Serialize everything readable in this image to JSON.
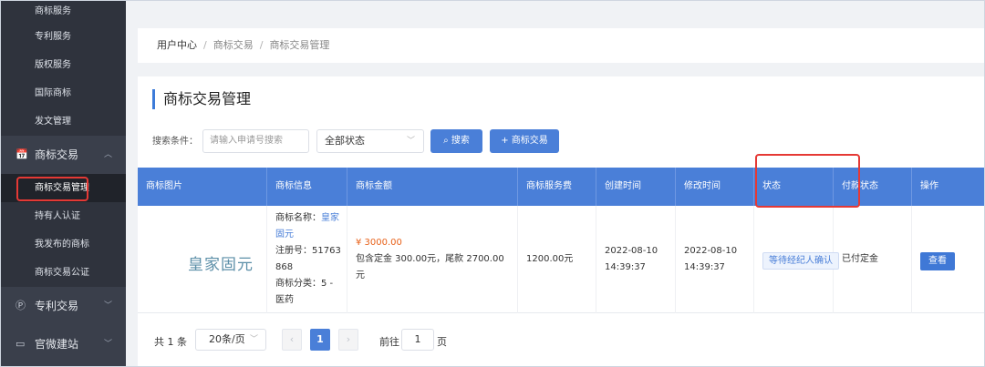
{
  "sidebar": {
    "top_items": [
      {
        "label": "商标服务"
      },
      {
        "label": "专利服务"
      },
      {
        "label": "版权服务"
      },
      {
        "label": "国际商标"
      },
      {
        "label": "发文管理"
      }
    ],
    "group_trademark": {
      "label": "商标交易",
      "icon": "shop-icon"
    },
    "sub_items": [
      {
        "label": "商标交易管理",
        "active": true
      },
      {
        "label": "持有人认证"
      },
      {
        "label": "我发布的商标"
      },
      {
        "label": "商标交易公证"
      }
    ],
    "group_patent": {
      "label": "专利交易",
      "icon": "patent-icon"
    },
    "group_site": {
      "label": "官微建站",
      "icon": "monitor-icon"
    }
  },
  "breadcrumb": {
    "home": "用户中心",
    "level1": "商标交易",
    "level2": "商标交易管理"
  },
  "page_title": "商标交易管理",
  "search": {
    "label": "搜索条件：",
    "placeholder": "请输入申请号搜索",
    "status_select": "全部状态",
    "search_button": "搜索",
    "add_button": "商标交易"
  },
  "table": {
    "headers": [
      "商标图片",
      "商标信息",
      "商标金额",
      "商标服务费",
      "创建时间",
      "修改时间",
      "状态",
      "付款状态",
      "操作"
    ],
    "rows": [
      {
        "logo_text": "皇家固元",
        "info_name_label": "商标名称：",
        "info_name": "皇家固元",
        "info_reg": "注册号：51763868",
        "info_class": "商标分类：5 - 医药",
        "amount": "¥ 3000.00",
        "amount_detail": "包含定金 300.00元，尾款 2700.00元",
        "service_fee": "1200.00元",
        "created": "2022-08-10 14:39:37",
        "modified": "2022-08-10 14:39:37",
        "status": "等待经纪人确认",
        "pay_status": "已付定金",
        "action": "查看"
      }
    ]
  },
  "pagination": {
    "total": "共 1 条",
    "page_size": "20条/页",
    "current_page": "1",
    "goto_label": "前往",
    "goto_value": "1",
    "goto_unit": "页"
  },
  "colors": {
    "accent": "#4a7fd8",
    "sidebar": "#3a3f4b",
    "highlight": "#e53935",
    "price": "#e8621a"
  }
}
